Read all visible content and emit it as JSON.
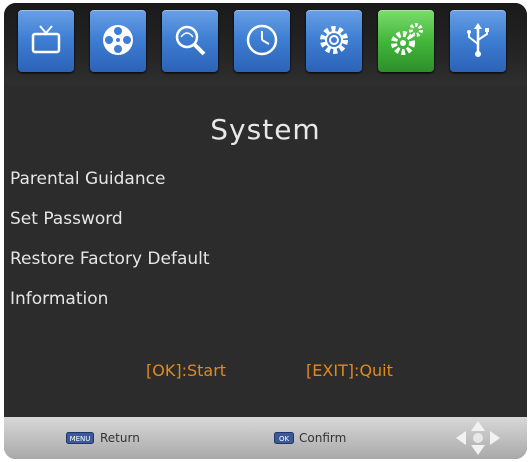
{
  "title": "System",
  "tabs": [
    {
      "icon": "tv-icon",
      "active": false
    },
    {
      "icon": "film-reel-icon",
      "active": false
    },
    {
      "icon": "satellite-search-icon",
      "active": false
    },
    {
      "icon": "clock-icon",
      "active": false
    },
    {
      "icon": "settings-gear-icon",
      "active": false
    },
    {
      "icon": "system-gears-icon",
      "active": true
    },
    {
      "icon": "usb-icon",
      "active": false
    }
  ],
  "menu": {
    "items": [
      {
        "label": "Parental Guidance"
      },
      {
        "label": "Set Password"
      },
      {
        "label": "Restore Factory Default"
      },
      {
        "label": "Information"
      }
    ]
  },
  "hints": {
    "ok": "[OK]:Start",
    "exit": "[EXIT]:Quit"
  },
  "bottom": {
    "return_key": "MENU",
    "return_label": "Return",
    "confirm_key": "OK",
    "confirm_label": "Confirm"
  },
  "colors": {
    "tab_blue": "#3f7fd3",
    "tab_active_green": "#43b83a",
    "hint_orange": "#e08a1e",
    "background": "#2c2c2c"
  }
}
